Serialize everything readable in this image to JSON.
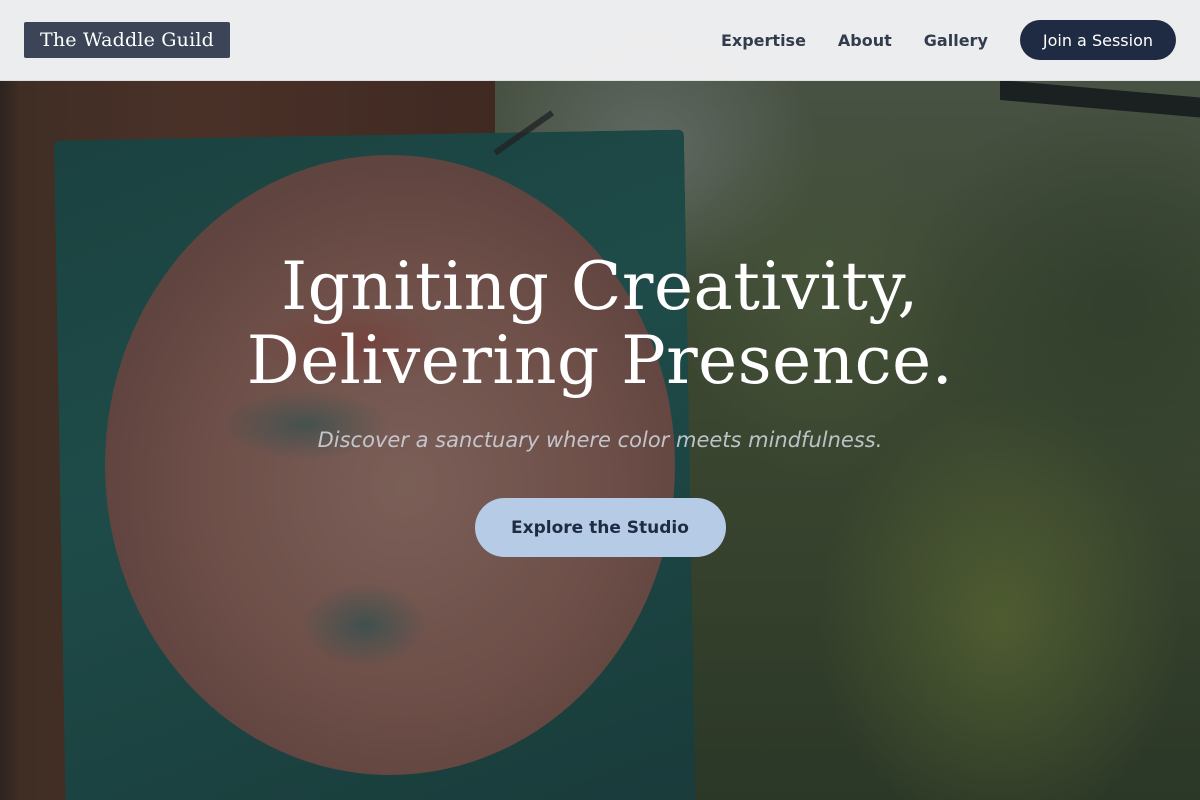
{
  "header": {
    "logo_text": "The Waddle Guild",
    "nav": [
      {
        "label": "Expertise"
      },
      {
        "label": "About"
      },
      {
        "label": "Gallery"
      }
    ],
    "cta_label": "Join a Session"
  },
  "hero": {
    "headline_line1": "Igniting Creativity,",
    "headline_line2": "Delivering Presence.",
    "subtitle": "Discover a sanctuary where color meets mindfulness.",
    "button_label": "Explore the Studio"
  },
  "colors": {
    "header_bg": "#f6f7f9",
    "logo_bg": "#3b4557",
    "primary_dark": "#1f2b42",
    "button_light": "#b6cbe6"
  },
  "background_image": "painted-face-mural-in-garden"
}
